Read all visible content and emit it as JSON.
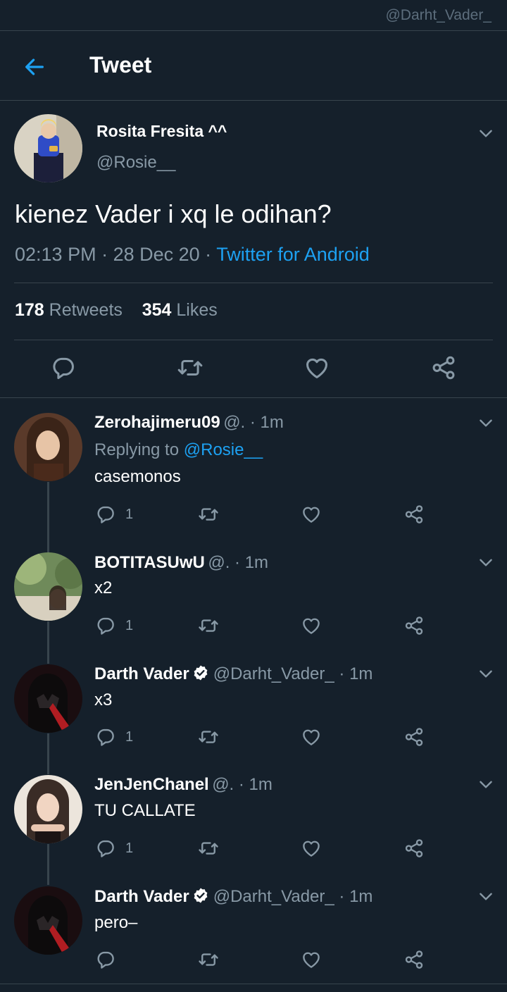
{
  "watermark": "@Darht_Vader_",
  "header": {
    "title": "Tweet"
  },
  "tweet": {
    "author_name": "Rosita Fresita ^^",
    "author_handle": "@Rosie__",
    "text": "kienez Vader i xq le odihan?",
    "time": "02:13 PM",
    "date": "28 Dec 20",
    "source": "Twitter for Android",
    "retweets_count": "178",
    "retweets_label": "Retweets",
    "likes_count": "354",
    "likes_label": "Likes"
  },
  "replies": [
    {
      "name": "Zerohajimeru09",
      "handle": "@.",
      "time": "1m",
      "replying_prefix": "Replying to",
      "replying_to": "@Rosie__",
      "text": "casemonos",
      "reply_count": "1",
      "verified": false
    },
    {
      "name": "BOTITASUwU",
      "handle": "@.",
      "time": "1m",
      "text": "x2",
      "reply_count": "1",
      "verified": false
    },
    {
      "name": "Darth Vader",
      "handle": "@Darht_Vader_",
      "time": "1m",
      "text": "x3",
      "reply_count": "1",
      "verified": true
    },
    {
      "name": "JenJenChanel",
      "handle": "@.",
      "time": "1m",
      "text": "TU CALLATE",
      "reply_count": "1",
      "verified": false
    },
    {
      "name": "Darth Vader",
      "handle": "@Darht_Vader_",
      "time": "1m",
      "text": "pero–",
      "reply_count": "",
      "verified": true
    }
  ],
  "icons": {
    "back": "arrow-left-icon",
    "chevron": "chevron-down-icon",
    "reply": "comment-icon",
    "retweet": "retweet-icon",
    "like": "heart-icon",
    "share": "share-icon",
    "verified": "verified-badge-icon"
  },
  "colors": {
    "background": "#15202b",
    "accent": "#1da1f2",
    "muted": "#8899a6",
    "divider": "#38444d"
  }
}
